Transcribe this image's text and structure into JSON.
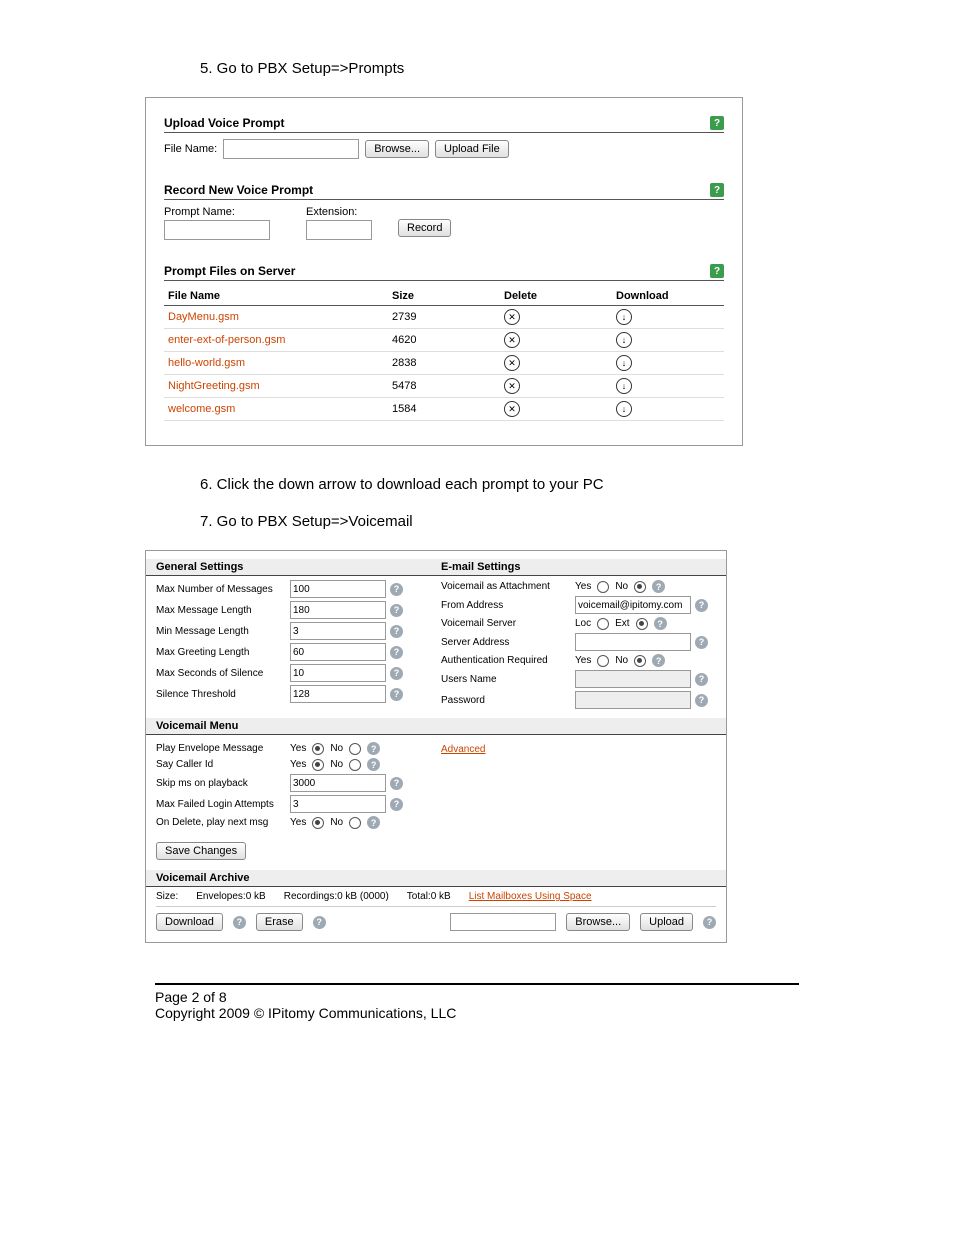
{
  "instructions": {
    "step5": "5. Go to PBX Setup=>Prompts",
    "step6": "6. Click the down arrow to download each prompt to your PC",
    "step7": "7. Go to PBX Setup=>Voicemail"
  },
  "upload_prompt": {
    "title": "Upload Voice Prompt",
    "file_name_label": "File Name:",
    "file_name_value": "",
    "browse_btn": "Browse...",
    "upload_btn": "Upload File"
  },
  "record_prompt": {
    "title": "Record New Voice Prompt",
    "prompt_name_label": "Prompt Name:",
    "prompt_name_value": "",
    "extension_label": "Extension:",
    "extension_value": "",
    "record_btn": "Record"
  },
  "files_table": {
    "title": "Prompt Files on Server",
    "headers": {
      "name": "File Name",
      "size": "Size",
      "delete": "Delete",
      "download": "Download"
    },
    "rows": [
      {
        "name": "DayMenu.gsm",
        "size": "2739"
      },
      {
        "name": "enter-ext-of-person.gsm",
        "size": "4620"
      },
      {
        "name": "hello-world.gsm",
        "size": "2838"
      },
      {
        "name": "NightGreeting.gsm",
        "size": "5478"
      },
      {
        "name": "welcome.gsm",
        "size": "1584"
      }
    ]
  },
  "voicemail": {
    "general_title": "General Settings",
    "email_title": "E-mail Settings",
    "menu_title": "Voicemail Menu",
    "archive_title": "Voicemail Archive",
    "general": [
      {
        "label": "Max Number of Messages",
        "value": "100"
      },
      {
        "label": "Max Message Length",
        "value": "180"
      },
      {
        "label": "Min Message Length",
        "value": "3"
      },
      {
        "label": "Max Greeting Length",
        "value": "60"
      },
      {
        "label": "Max Seconds of Silence",
        "value": "10"
      },
      {
        "label": "Silence Threshold",
        "value": "128"
      }
    ],
    "email": {
      "attach_label": "Voicemail as Attachment",
      "attach_sel": "No",
      "from_label": "From Address",
      "from_value": "voicemail@ipitomy.com",
      "server_label": "Voicemail Server",
      "server_sel": "Ext",
      "server_addr_label": "Server Address",
      "server_addr_value": "",
      "auth_label": "Authentication Required",
      "auth_sel": "No",
      "user_label": "Users Name",
      "user_value": "",
      "pass_label": "Password",
      "pass_value": "",
      "yes": "Yes",
      "no": "No",
      "loc": "Loc",
      "ext": "Ext"
    },
    "menu": {
      "play_env_label": "Play Envelope Message",
      "say_caller_label": "Say Caller Id",
      "skip_label": "Skip ms on playback",
      "skip_value": "3000",
      "max_failed_label": "Max Failed Login Attempts",
      "max_failed_value": "3",
      "on_delete_label": "On Delete, play next msg",
      "advanced_link": "Advanced",
      "yes": "Yes",
      "no": "No"
    },
    "save_btn": "Save Changes",
    "archive": {
      "size_label": "Size:",
      "envelopes": "Envelopes:0 kB",
      "recordings": "Recordings:0 kB (0000)",
      "total": "Total:0 kB",
      "list_link": "List Mailboxes Using Space",
      "download_btn": "Download",
      "erase_btn": "Erase",
      "browse_btn": "Browse...",
      "upload_btn": "Upload"
    }
  },
  "footer": {
    "page": "Page 2 of 8",
    "copyright": "Copyright 2009 © IPitomy Communications, LLC"
  }
}
